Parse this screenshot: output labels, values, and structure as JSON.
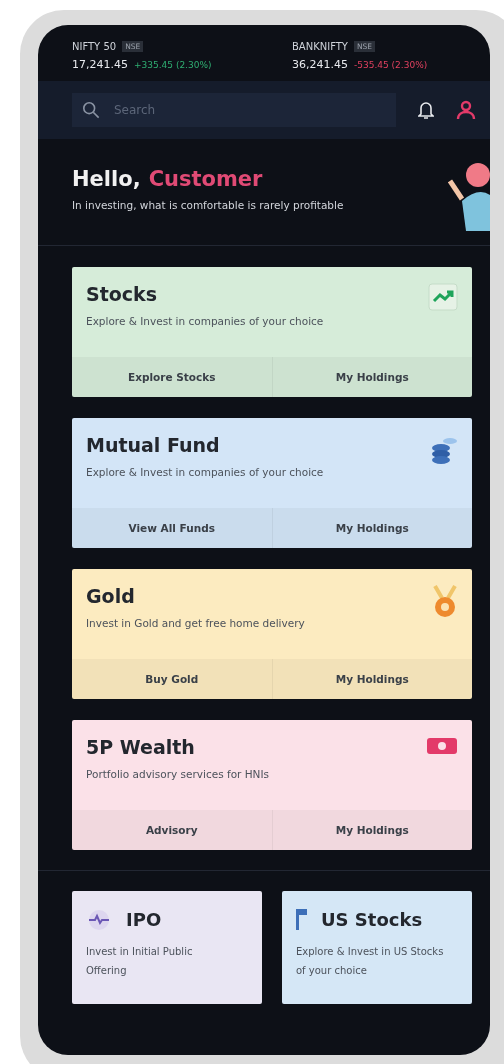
{
  "tickers": [
    {
      "name": "NIFTY 50",
      "exchange": "NSE",
      "value": "17,241.45",
      "change": "+335.45 (2.30%)",
      "rising": true
    },
    {
      "name": "BANKNIFTY",
      "exchange": "NSE",
      "value": "36,241.45",
      "change": "-535.45 (2.30%)",
      "rising": false
    }
  ],
  "search": {
    "placeholder": "Search"
  },
  "greeting": {
    "salutation": "Hello,",
    "name": "Customer",
    "tagline": "In investing, what is comfortable is rarely profitable"
  },
  "products": [
    {
      "title": "Stocks",
      "subtitle": "Explore & Invest in companies of your choice",
      "kind": "trend",
      "color": "#d6ecd9",
      "actions": [
        "Explore Stocks",
        "My Holdings"
      ]
    },
    {
      "title": "Mutual Fund",
      "subtitle": "Explore & Invest in companies of your choice",
      "kind": "coins",
      "color": "#d3e5f7",
      "actions": [
        "View All Funds",
        "My Holdings"
      ]
    },
    {
      "title": "Gold",
      "subtitle": "Invest in Gold and get free home delivery",
      "kind": "medal",
      "color": "#fcebc0",
      "actions": [
        "Buy Gold",
        "My Holdings"
      ]
    },
    {
      "title": "5P Wealth",
      "subtitle": "Portfolio advisory services for HNIs",
      "kind": "cash",
      "color": "#fbe1e8",
      "actions": [
        "Advisory",
        "My Holdings"
      ]
    }
  ],
  "shortcuts": [
    {
      "title": "IPO",
      "subtitle": "Invest in Initial Public Offering",
      "kind": "pulse",
      "color": "#e9e6f3"
    },
    {
      "title": "US Stocks",
      "subtitle": "Explore & Invest in US Stocks of your choice",
      "kind": "flag",
      "color": "#d5e7f6"
    }
  ]
}
